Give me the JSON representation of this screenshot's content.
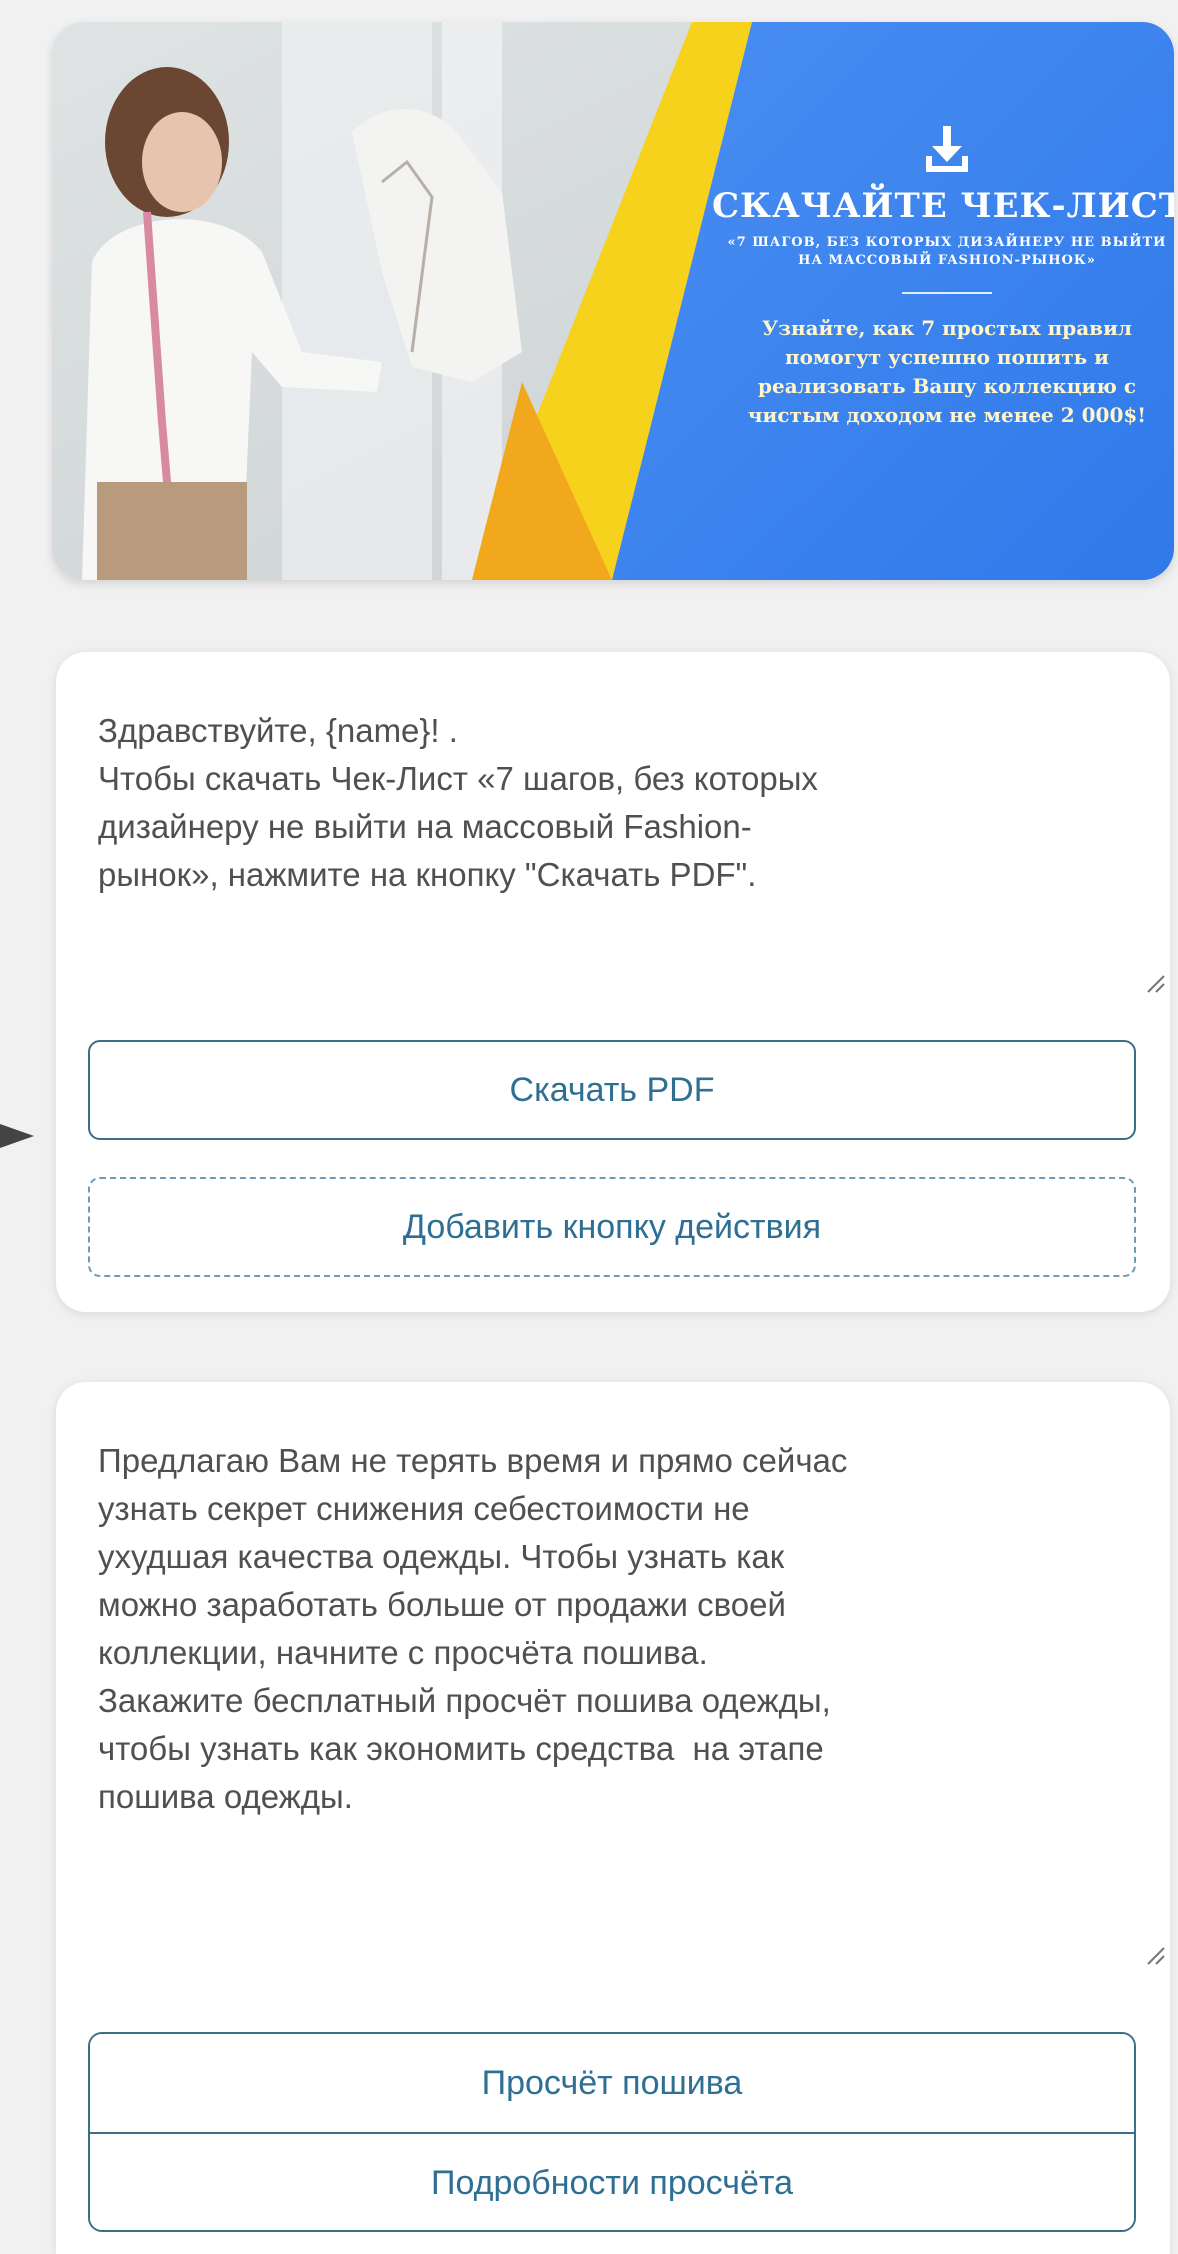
{
  "banner": {
    "title": "СКАЧАЙТЕ ЧЕК-ЛИСТ",
    "subtitle": "«7 ШАГОВ, БЕЗ КОТОРЫХ ДИЗАЙНЕРУ НЕ ВЫЙТИ НА МАССОВЫЙ FASHION-РЫНОК»",
    "description": "Узнайте, как 7 простых правил помогут успешно пошить и реализовать Вашу коллекцию с чистым доходом не менее 2 000$!",
    "icon": "download-icon",
    "colors": {
      "blue": "#3b82f0",
      "yellow": "#f7d21c",
      "orange": "#f2a81d"
    }
  },
  "card1": {
    "text": "Здравствуйте, {name}! .\nЧтобы скачать Чек-Лист «7 шагов, без которых\nдизайнеру не выйти на массовый Fashion-\nрынок», нажмите на кнопку \"Скачать PDF\".",
    "button_pdf": "Скачать PDF",
    "button_add": "Добавить кнопку действия"
  },
  "card2": {
    "text": "Предлагаю Вам не терять время и прямо сейчас\nузнать секрет снижения себестоимости не\nухудшая качества одежды. Чтобы узнать как\nможно заработать больше от продажи своей\nколлекции, начните с просчёта пошива.\nЗакажите бесплатный просчёт пошива одежды,\nчтобы узнать как экономить средства  на этапе\nпошива одежды.",
    "button_1": "Просчёт пошива",
    "button_2": "Подробности просчёта"
  }
}
